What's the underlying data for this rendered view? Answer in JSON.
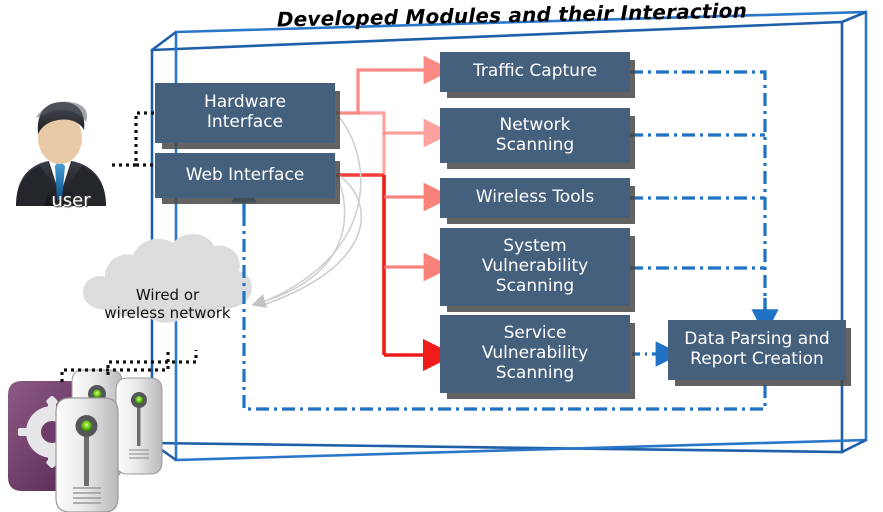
{
  "diagram": {
    "title": "Developed Modules and their Interaction",
    "frame_color": "#1f5fa9",
    "module_fill": "#44607d",
    "module_text_color": "#ffffff",
    "red_arrow_color": "#ff4545",
    "blue_arrow_color": "#1f72c4",
    "dotted_link_color": "#1a1a1a",
    "gray_arrow_color": "#bdbdbd"
  },
  "actors": {
    "user": {
      "label": "user",
      "icon": "user-avatar-icon"
    },
    "network_cloud": {
      "line1": "Wired or",
      "line2": "wireless network",
      "icon": "cloud-icon"
    },
    "servers": {
      "icon": "servers-icon",
      "count": 3
    }
  },
  "interfaces": [
    {
      "id": "hardware-interface",
      "line1": "Hardware",
      "line2": "Interface"
    },
    {
      "id": "web-interface",
      "line1": "Web Interface",
      "line2": ""
    }
  ],
  "modules": [
    {
      "id": "traffic-capture",
      "line1": "Traffic Capture",
      "line2": "",
      "line3": ""
    },
    {
      "id": "network-scanning",
      "line1": "Network",
      "line2": "Scanning",
      "line3": ""
    },
    {
      "id": "wireless-tools",
      "line1": "Wireless Tools",
      "line2": "",
      "line3": ""
    },
    {
      "id": "system-vulnerability-scanning",
      "line1": "System",
      "line2": "Vulnerability",
      "line3": "Scanning"
    },
    {
      "id": "service-vulnerability-scanning",
      "line1": "Service",
      "line2": "Vulnerability",
      "line3": "Scanning"
    }
  ],
  "output": {
    "id": "data-parsing-and-report-creation",
    "line1": "Data Parsing and",
    "line2": "Report Creation"
  }
}
